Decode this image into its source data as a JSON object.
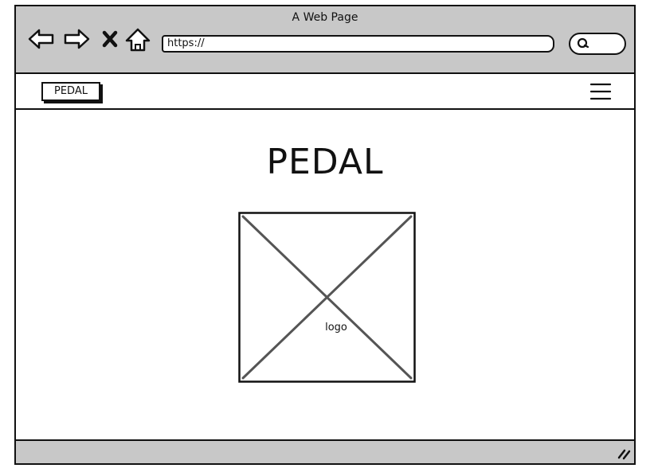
{
  "window": {
    "title": "A Web Page"
  },
  "toolbar": {
    "back_icon": "back-arrow-icon",
    "forward_icon": "forward-arrow-icon",
    "stop_icon": "close-icon",
    "home_icon": "home-icon",
    "url": "https://",
    "search_icon": "search-icon"
  },
  "navbar": {
    "brand_label": "PEDAL",
    "menu_icon": "hamburger-menu-icon"
  },
  "main": {
    "title": "PEDAL",
    "logo_label": "logo"
  },
  "statusbar": {
    "resize_icon": "resize-grip-icon"
  },
  "colors": {
    "chrome_bg": "#c8c8c8",
    "stroke": "#111111",
    "placeholder_cross": "#555555"
  }
}
